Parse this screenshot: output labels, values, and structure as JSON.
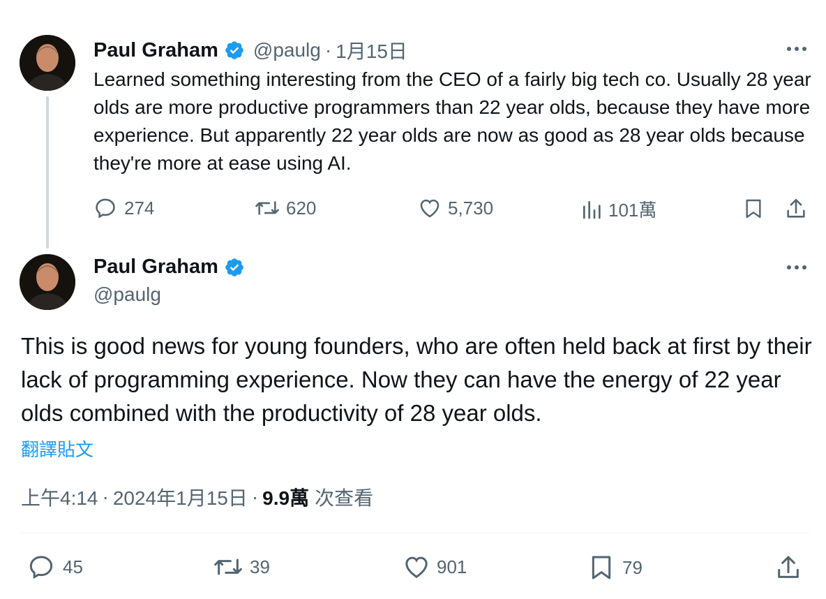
{
  "tweet1": {
    "name": "Paul Graham",
    "handle": "@paulg",
    "separator": "·",
    "date": "1月15日",
    "text": "Learned something interesting from the CEO of a fairly big tech co. Usually 28 year olds are more productive programmers than 22 year olds, because they have more experience. But apparently 22 year olds are now as good as 28 year olds because they're more at ease using AI.",
    "replies": "274",
    "reposts": "620",
    "likes": "5,730",
    "views": "101萬"
  },
  "tweet2": {
    "name": "Paul Graham",
    "handle": "@paulg",
    "text": "This is good news for young founders, who are often held back at first by their lack of programming experience. Now they can have the energy of 22 year olds combined with the productivity of 28 year olds.",
    "translate": "翻譯貼文",
    "time": "上午4:14",
    "sep1": "·",
    "date": "2024年1月15日",
    "sep2": "·",
    "views_count": "9.9萬",
    "views_label": "次查看",
    "replies": "45",
    "reposts": "39",
    "likes": "901",
    "bookmarks": "79"
  },
  "colors": {
    "verified_badge": "#1d9bf0",
    "link": "#1d9bf0",
    "muted": "#536471",
    "text": "#0f1419"
  }
}
